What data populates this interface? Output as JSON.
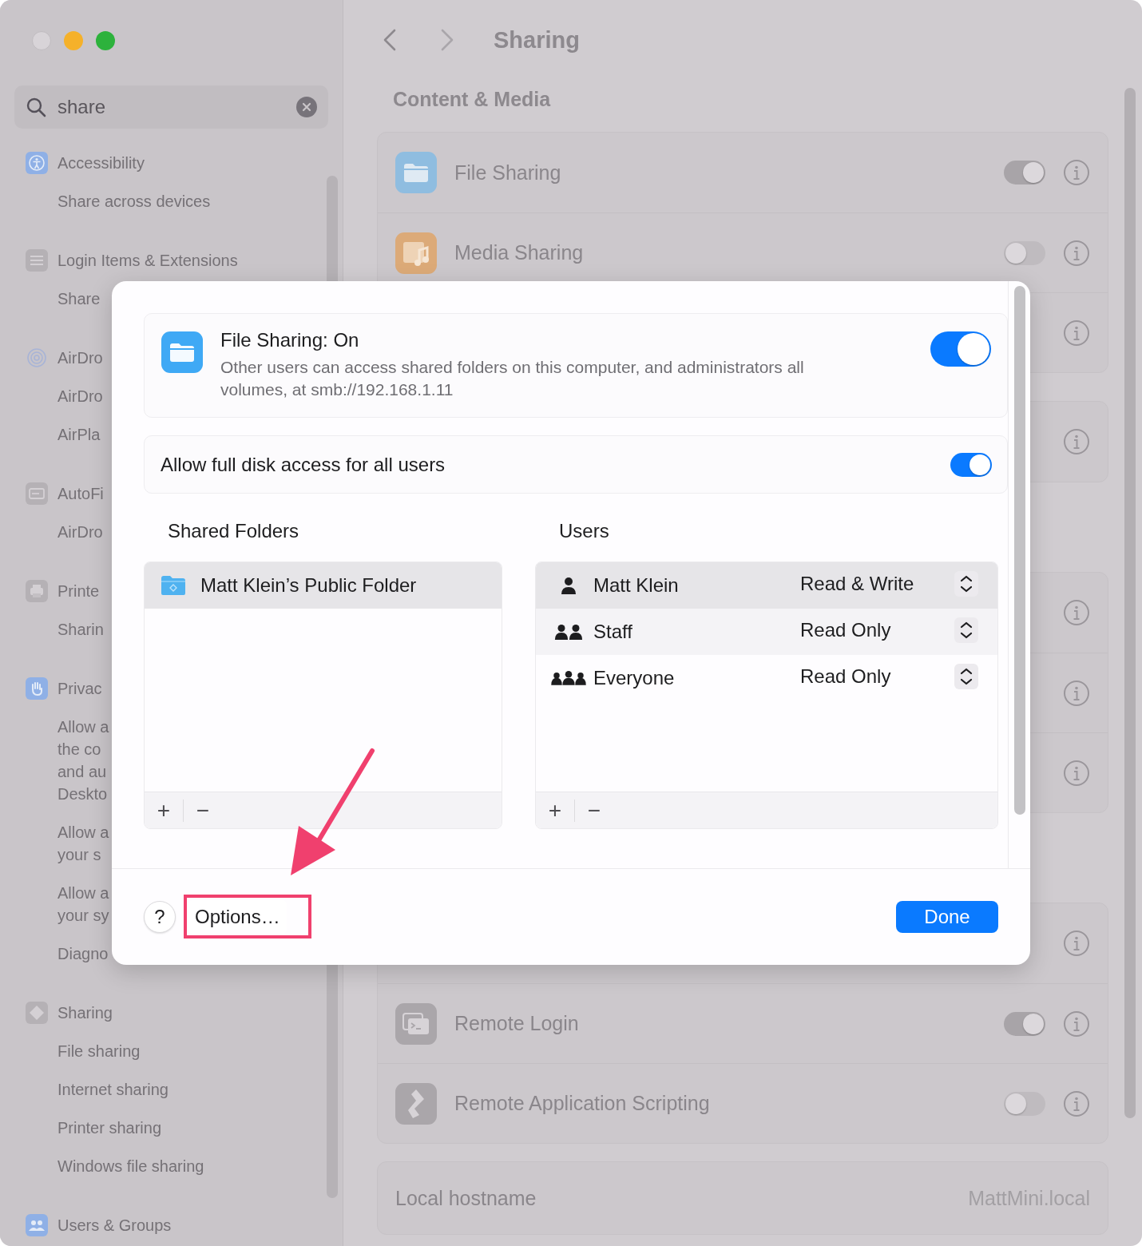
{
  "window": {
    "title": "Sharing"
  },
  "sidebar": {
    "search": {
      "value": "share"
    },
    "groups": [
      {
        "label": "Accessibility",
        "items": [
          {
            "lines": [
              "Share across devices"
            ]
          }
        ]
      },
      {
        "label": "Login Items & Extensions",
        "items": [
          {
            "lines": [
              "Share"
            ]
          }
        ]
      },
      {
        "label": "AirDro",
        "items": [
          {
            "lines": [
              "AirDro"
            ]
          },
          {
            "lines": [
              "AirPla"
            ]
          }
        ]
      },
      {
        "label": "AutoFi",
        "items": [
          {
            "lines": [
              "AirDro"
            ]
          }
        ]
      },
      {
        "label": "Printe",
        "items": [
          {
            "lines": [
              "Sharin"
            ]
          }
        ]
      },
      {
        "label": "Privac",
        "items": [
          {
            "lines": [
              "Allow a",
              "the co",
              "and au",
              "Deskto"
            ]
          },
          {
            "lines": [
              "Allow a",
              "your s"
            ]
          },
          {
            "lines": [
              "Allow a",
              "your sy"
            ]
          },
          {
            "lines": [
              "Diagno"
            ]
          }
        ]
      },
      {
        "label": "Sharing",
        "items": [
          {
            "lines": [
              "File sharing"
            ]
          },
          {
            "lines": [
              "Internet sharing"
            ]
          },
          {
            "lines": [
              "Printer sharing"
            ]
          },
          {
            "lines": [
              "Windows file sharing"
            ]
          }
        ]
      },
      {
        "label": "Users & Groups"
      }
    ]
  },
  "content": {
    "heading": "Content & Media",
    "sections": [
      {
        "rows": [
          {
            "kind": "service",
            "label": "File Sharing",
            "on": true
          },
          {
            "kind": "service",
            "label": "Media Sharing",
            "on": false
          },
          {
            "kind": "covered"
          }
        ]
      },
      {
        "rows": [
          {
            "kind": "covered"
          }
        ]
      },
      {
        "rows": [
          {
            "kind": "covered"
          },
          {
            "kind": "covered"
          },
          {
            "kind": "covered"
          }
        ]
      },
      {
        "rows": [
          {
            "kind": "covered"
          },
          {
            "kind": "service",
            "label": "Remote Login",
            "on": true
          },
          {
            "kind": "service",
            "label": "Remote Application Scripting",
            "on": false
          }
        ]
      },
      {
        "rows": [
          {
            "kind": "value",
            "label": "Local hostname",
            "value": "MattMini.local"
          }
        ]
      }
    ]
  },
  "sheet": {
    "status": {
      "title": "File Sharing: On",
      "description": "Other users can access shared folders on this computer, and administrators all volumes, at smb://192.168.1.11",
      "on": true
    },
    "full_disk": {
      "label": "Allow full disk access for all users",
      "on": true
    },
    "shared_folders": {
      "heading": "Shared Folders",
      "items": [
        {
          "name": "Matt Klein’s Public Folder",
          "selected": true
        }
      ],
      "add": "+",
      "remove": "−"
    },
    "users": {
      "heading": "Users",
      "items": [
        {
          "name": "Matt Klein",
          "permission": "Read & Write",
          "selected": true
        },
        {
          "name": "Staff",
          "permission": "Read Only",
          "selected": false
        },
        {
          "name": "Everyone",
          "permission": "Read Only",
          "selected": false
        }
      ],
      "add": "+",
      "remove": "−"
    },
    "help": "?",
    "options": "Options…",
    "done": "Done"
  }
}
